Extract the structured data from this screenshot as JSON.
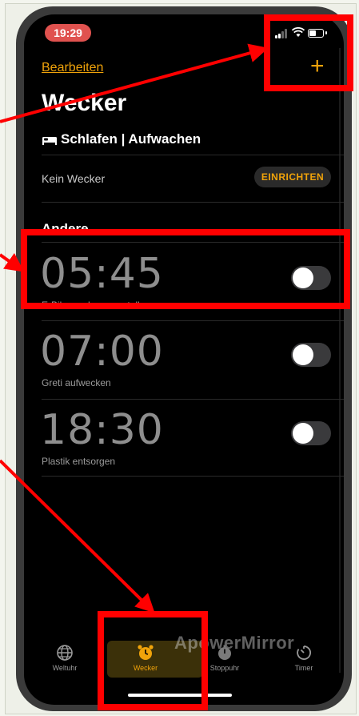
{
  "status": {
    "time": "19:29"
  },
  "header": {
    "edit_label": "Bearbeiten",
    "add_label": "+",
    "title": "Wecker"
  },
  "sleep": {
    "label": "Schlafen | Aufwachen",
    "no_alarm": "Kein Wecker",
    "setup_label": "EINRICHTEN"
  },
  "section": {
    "other_label": "Andere"
  },
  "alarms": [
    {
      "time": "05:45",
      "label": "E-Bike nach vorne stellen",
      "enabled": false
    },
    {
      "time": "07:00",
      "label": "Greti aufwecken",
      "enabled": false
    },
    {
      "time": "18:30",
      "label": "Plastik entsorgen",
      "enabled": false
    }
  ],
  "tabs": [
    {
      "label": "Weltuhr",
      "icon": "globe-icon",
      "active": false
    },
    {
      "label": "Wecker",
      "icon": "alarm-clock-icon",
      "active": true
    },
    {
      "label": "Stoppuhr",
      "icon": "stopwatch-icon",
      "active": false
    },
    {
      "label": "Timer",
      "icon": "timer-icon",
      "active": false
    }
  ],
  "watermark": "ApowerMirror",
  "colors": {
    "accent": "#f0a30a",
    "annotation": "#ff0000",
    "background": "#000000"
  }
}
